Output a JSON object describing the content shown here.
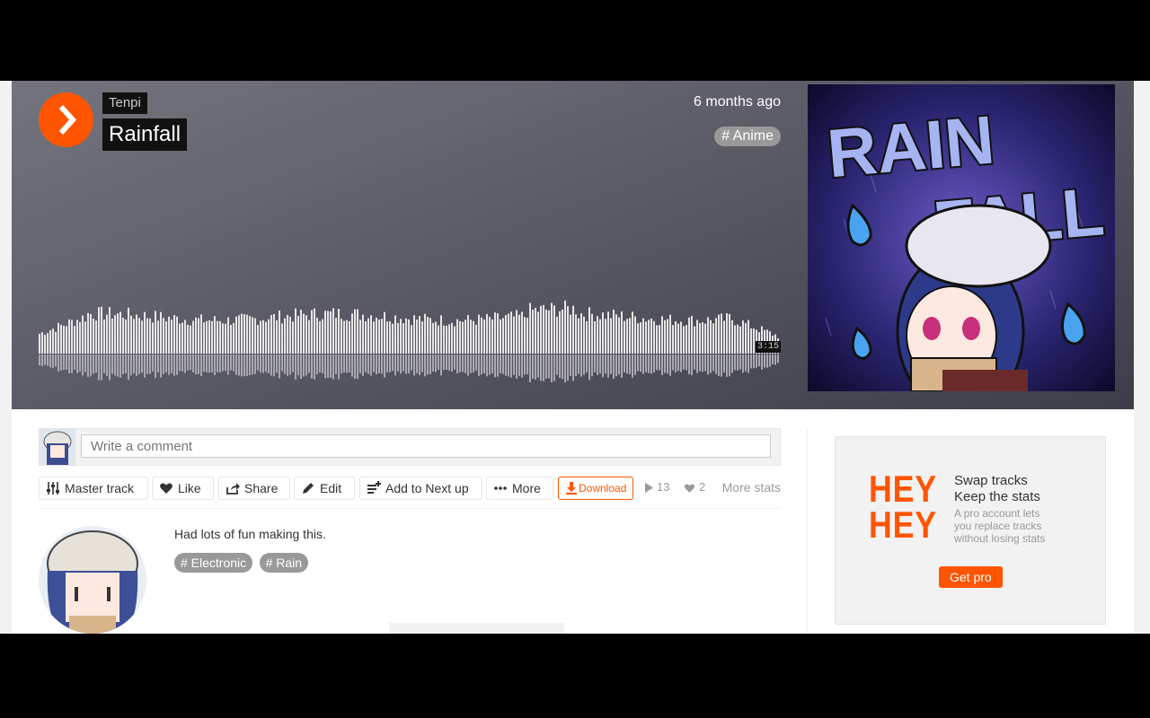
{
  "track": {
    "artist": "Tenpi",
    "title": "Rainfall",
    "posted": "6 months ago",
    "genre_tag": "# Anime",
    "duration": "3:15",
    "artwork_text_1": "RAIN",
    "artwork_text_2": "FALL"
  },
  "comment": {
    "placeholder": "Write a comment"
  },
  "actions": {
    "master": "Master track",
    "like": "Like",
    "share": "Share",
    "edit": "Edit",
    "next_up": "Add to Next up",
    "more": "More",
    "download": "Download",
    "plays": "13",
    "likes": "2",
    "more_stats": "More stats"
  },
  "description": {
    "text": "Had lots of fun making this.",
    "tags": [
      "# Electronic",
      "# Rain"
    ]
  },
  "promo": {
    "hey1": "HEY",
    "hey2": "HEY",
    "heading_1": "Swap tracks",
    "heading_2": "Keep the stats",
    "sub_1": "A pro account lets",
    "sub_2": "you replace tracks",
    "sub_3": "without losing stats",
    "button": "Get pro"
  },
  "colors": {
    "accent": "#ff5500",
    "hero_top": "#74747e",
    "hero_bottom": "#3e3e4b"
  }
}
